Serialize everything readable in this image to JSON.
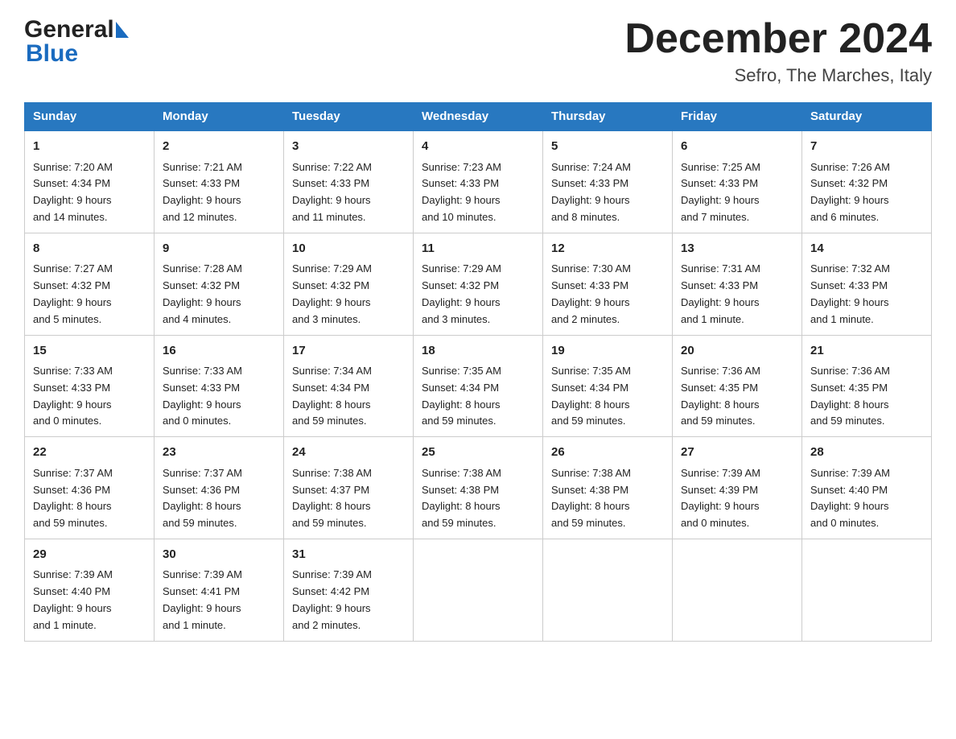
{
  "header": {
    "month_year": "December 2024",
    "location": "Sefro, The Marches, Italy"
  },
  "logo": {
    "line1": "General",
    "line2": "Blue"
  },
  "weekdays": [
    "Sunday",
    "Monday",
    "Tuesday",
    "Wednesday",
    "Thursday",
    "Friday",
    "Saturday"
  ],
  "weeks": [
    [
      {
        "day": "1",
        "sunrise": "7:20 AM",
        "sunset": "4:34 PM",
        "daylight": "9 hours and 14 minutes."
      },
      {
        "day": "2",
        "sunrise": "7:21 AM",
        "sunset": "4:33 PM",
        "daylight": "9 hours and 12 minutes."
      },
      {
        "day": "3",
        "sunrise": "7:22 AM",
        "sunset": "4:33 PM",
        "daylight": "9 hours and 11 minutes."
      },
      {
        "day": "4",
        "sunrise": "7:23 AM",
        "sunset": "4:33 PM",
        "daylight": "9 hours and 10 minutes."
      },
      {
        "day": "5",
        "sunrise": "7:24 AM",
        "sunset": "4:33 PM",
        "daylight": "9 hours and 8 minutes."
      },
      {
        "day": "6",
        "sunrise": "7:25 AM",
        "sunset": "4:33 PM",
        "daylight": "9 hours and 7 minutes."
      },
      {
        "day": "7",
        "sunrise": "7:26 AM",
        "sunset": "4:32 PM",
        "daylight": "9 hours and 6 minutes."
      }
    ],
    [
      {
        "day": "8",
        "sunrise": "7:27 AM",
        "sunset": "4:32 PM",
        "daylight": "9 hours and 5 minutes."
      },
      {
        "day": "9",
        "sunrise": "7:28 AM",
        "sunset": "4:32 PM",
        "daylight": "9 hours and 4 minutes."
      },
      {
        "day": "10",
        "sunrise": "7:29 AM",
        "sunset": "4:32 PM",
        "daylight": "9 hours and 3 minutes."
      },
      {
        "day": "11",
        "sunrise": "7:29 AM",
        "sunset": "4:32 PM",
        "daylight": "9 hours and 3 minutes."
      },
      {
        "day": "12",
        "sunrise": "7:30 AM",
        "sunset": "4:33 PM",
        "daylight": "9 hours and 2 minutes."
      },
      {
        "day": "13",
        "sunrise": "7:31 AM",
        "sunset": "4:33 PM",
        "daylight": "9 hours and 1 minute."
      },
      {
        "day": "14",
        "sunrise": "7:32 AM",
        "sunset": "4:33 PM",
        "daylight": "9 hours and 1 minute."
      }
    ],
    [
      {
        "day": "15",
        "sunrise": "7:33 AM",
        "sunset": "4:33 PM",
        "daylight": "9 hours and 0 minutes."
      },
      {
        "day": "16",
        "sunrise": "7:33 AM",
        "sunset": "4:33 PM",
        "daylight": "9 hours and 0 minutes."
      },
      {
        "day": "17",
        "sunrise": "7:34 AM",
        "sunset": "4:34 PM",
        "daylight": "8 hours and 59 minutes."
      },
      {
        "day": "18",
        "sunrise": "7:35 AM",
        "sunset": "4:34 PM",
        "daylight": "8 hours and 59 minutes."
      },
      {
        "day": "19",
        "sunrise": "7:35 AM",
        "sunset": "4:34 PM",
        "daylight": "8 hours and 59 minutes."
      },
      {
        "day": "20",
        "sunrise": "7:36 AM",
        "sunset": "4:35 PM",
        "daylight": "8 hours and 59 minutes."
      },
      {
        "day": "21",
        "sunrise": "7:36 AM",
        "sunset": "4:35 PM",
        "daylight": "8 hours and 59 minutes."
      }
    ],
    [
      {
        "day": "22",
        "sunrise": "7:37 AM",
        "sunset": "4:36 PM",
        "daylight": "8 hours and 59 minutes."
      },
      {
        "day": "23",
        "sunrise": "7:37 AM",
        "sunset": "4:36 PM",
        "daylight": "8 hours and 59 minutes."
      },
      {
        "day": "24",
        "sunrise": "7:38 AM",
        "sunset": "4:37 PM",
        "daylight": "8 hours and 59 minutes."
      },
      {
        "day": "25",
        "sunrise": "7:38 AM",
        "sunset": "4:38 PM",
        "daylight": "8 hours and 59 minutes."
      },
      {
        "day": "26",
        "sunrise": "7:38 AM",
        "sunset": "4:38 PM",
        "daylight": "8 hours and 59 minutes."
      },
      {
        "day": "27",
        "sunrise": "7:39 AM",
        "sunset": "4:39 PM",
        "daylight": "9 hours and 0 minutes."
      },
      {
        "day": "28",
        "sunrise": "7:39 AM",
        "sunset": "4:40 PM",
        "daylight": "9 hours and 0 minutes."
      }
    ],
    [
      {
        "day": "29",
        "sunrise": "7:39 AM",
        "sunset": "4:40 PM",
        "daylight": "9 hours and 1 minute."
      },
      {
        "day": "30",
        "sunrise": "7:39 AM",
        "sunset": "4:41 PM",
        "daylight": "9 hours and 1 minute."
      },
      {
        "day": "31",
        "sunrise": "7:39 AM",
        "sunset": "4:42 PM",
        "daylight": "9 hours and 2 minutes."
      },
      null,
      null,
      null,
      null
    ]
  ],
  "labels": {
    "sunrise": "Sunrise:",
    "sunset": "Sunset:",
    "daylight": "Daylight:"
  }
}
